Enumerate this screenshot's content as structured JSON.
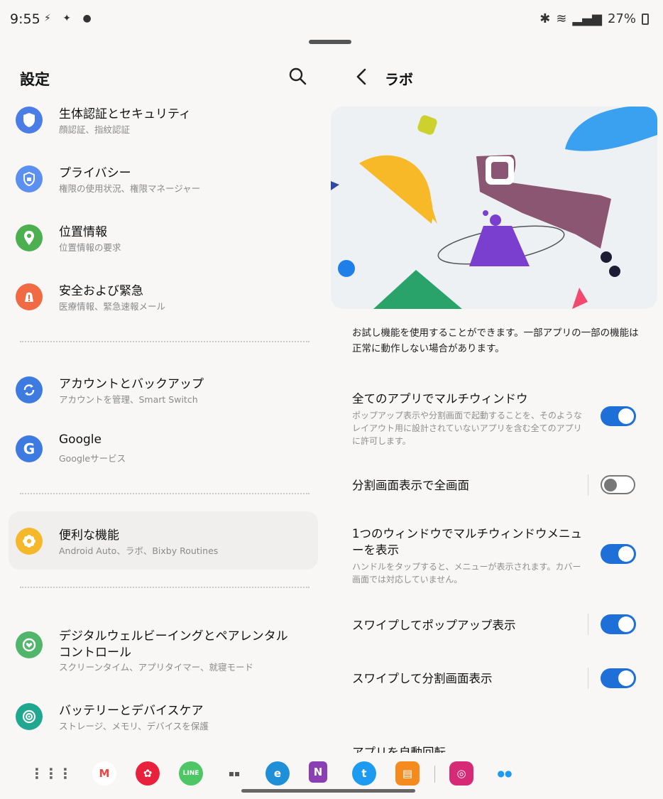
{
  "status": {
    "time": "9:55",
    "battery": "27%"
  },
  "left": {
    "title": "設定",
    "items": [
      {
        "title": "生体認証とセキュリティ",
        "sub": "顔認証、指紋認証",
        "color": "#4a7ee6",
        "icon": "shield-icon"
      },
      {
        "title": "プライバシー",
        "sub": "権限の使用状況、権限マネージャー",
        "color": "#5b8ff0",
        "icon": "privacy-shield-icon"
      },
      {
        "title": "位置情報",
        "sub": "位置情報の要求",
        "color": "#4caf50",
        "icon": "location-pin-icon"
      },
      {
        "title": "安全および緊急",
        "sub": "医療情報、緊急速報メール",
        "color": "#f06a43",
        "icon": "emergency-icon"
      },
      {
        "title": "アカウントとバックアップ",
        "sub": "アカウントを管理、Smart Switch",
        "color": "#3d7be0",
        "icon": "sync-icon"
      },
      {
        "title": "Google",
        "sub": "Googleサービス",
        "color": "#3d7be0",
        "icon": "google-icon"
      },
      {
        "title": "便利な機能",
        "sub": "Android Auto、ラボ、Bixby Routines",
        "color": "#f5b82a",
        "icon": "gear-flower-icon"
      },
      {
        "title": "デジタルウェルビーイングとペアレンタル",
        "title2": "コントロール",
        "sub": "スクリーンタイム、アプリタイマー、就寝モード",
        "color": "#51b66b",
        "icon": "wellbeing-icon"
      },
      {
        "title": "バッテリーとデバイスケア",
        "sub": "ストレージ、メモリ、デバイスを保護",
        "color": "#1fa88f",
        "icon": "device-care-icon"
      }
    ]
  },
  "right": {
    "title": "ラボ",
    "description": "お試し機能を使用することができます。一部アプリの一部の機能は正常に動作しない場合があります。",
    "options": [
      {
        "title": "全てのアプリでマルチウィンドウ",
        "sub": "ポップアップ表示や分割画面で起動することを、そのようなレイアウト用に設計されていないアプリを含む全てのアプリに許可します。",
        "on": "true"
      },
      {
        "title": "分割画面表示で全画面",
        "sub": "",
        "on": "false"
      },
      {
        "title": "1つのウィンドウでマルチウィンドウメニューを表示",
        "sub": "ハンドルをタップすると、メニューが表示されます。カバー画面では対応していません。",
        "on": "true"
      },
      {
        "title": "スワイプしてポップアップ表示",
        "sub": "",
        "on": "true"
      },
      {
        "title": "スワイプして分割画面表示",
        "sub": "",
        "on": "true"
      }
    ],
    "cut_item": "アプリを自動回転"
  },
  "dock": {
    "apps": [
      "Gmail",
      "Bouquet",
      "LINE",
      "Folder",
      "Edge",
      "OneNote",
      "Twitter",
      "Notes",
      "Instagram",
      "Folder2"
    ]
  }
}
